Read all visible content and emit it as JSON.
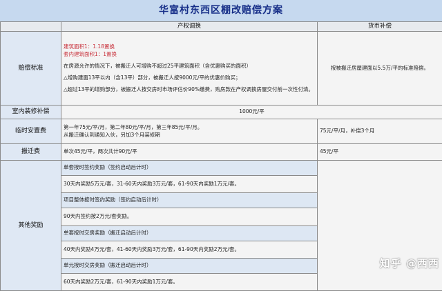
{
  "title": "华富村东西区棚改赔偿方案",
  "headers": {
    "property": "产权调换",
    "cash": "货币补偿"
  },
  "rows": {
    "compensation": {
      "label": "赔偿标准",
      "ratio_line1": "建筑面积1：1.18置换",
      "ratio_line2": "套内建筑面积1：1置换",
      "para1": "在房源允许的情况下，被搬迁人可增购不超过25平建筑面积（含优惠购买的面积）",
      "para2": "△增购建面13平以内（含13平）部分，被搬迁人按9000元/平的优惠价购买；",
      "para3": "△超过13平的增购部分，被搬迁人按交房时市场评估价90%缴费，购房款在产权调换房屋交付前一次性付清。",
      "cash": "按被搬迁房屋建面以5.5万/平的标准赔偿。"
    },
    "decoration": {
      "label": "室内装修补偿",
      "value": "1000元/平"
    },
    "temporary": {
      "label": "临时安置费",
      "property_line1": "第一年75元/平/月，第二年80元/平/月，第三年85元/平/月。",
      "property_line2": "从搬迁确认到通知入伙，另加3个月装修期",
      "cash": "75元/平/月，补偿3个月"
    },
    "moving": {
      "label": "搬迁费",
      "property": "单次45元/平，两次共计90元/平",
      "cash": "45元/平"
    },
    "rewards": {
      "label": "其他奖励",
      "items": [
        {
          "text": "单套按时签约奖励（签约启动后计时）",
          "style": "blue"
        },
        {
          "text": "30天内奖励5万元/套，31-60天内奖励3万元/套，61-90天内奖励1万元/套。",
          "style": "plain"
        },
        {
          "text": "项目整体按时签约奖励（签约启动后计时）",
          "style": "blue"
        },
        {
          "text": "90天内签约按2万元/套奖励。",
          "style": "plain"
        },
        {
          "text": "单套按时交房奖励（搬迁启动后计时）",
          "style": "blue"
        },
        {
          "text": "40天内奖励4万元/套，41-60天内奖励3万元/套，61-90天内奖励2万元/套。",
          "style": "plain"
        },
        {
          "text": "单元按时交房奖励（搬迁启动后计时）",
          "style": "blue"
        },
        {
          "text": "60天内奖励2万元/套，61-90天内奖励1万元/套。",
          "style": "plain"
        }
      ]
    }
  },
  "watermark": "知乎 @西西"
}
